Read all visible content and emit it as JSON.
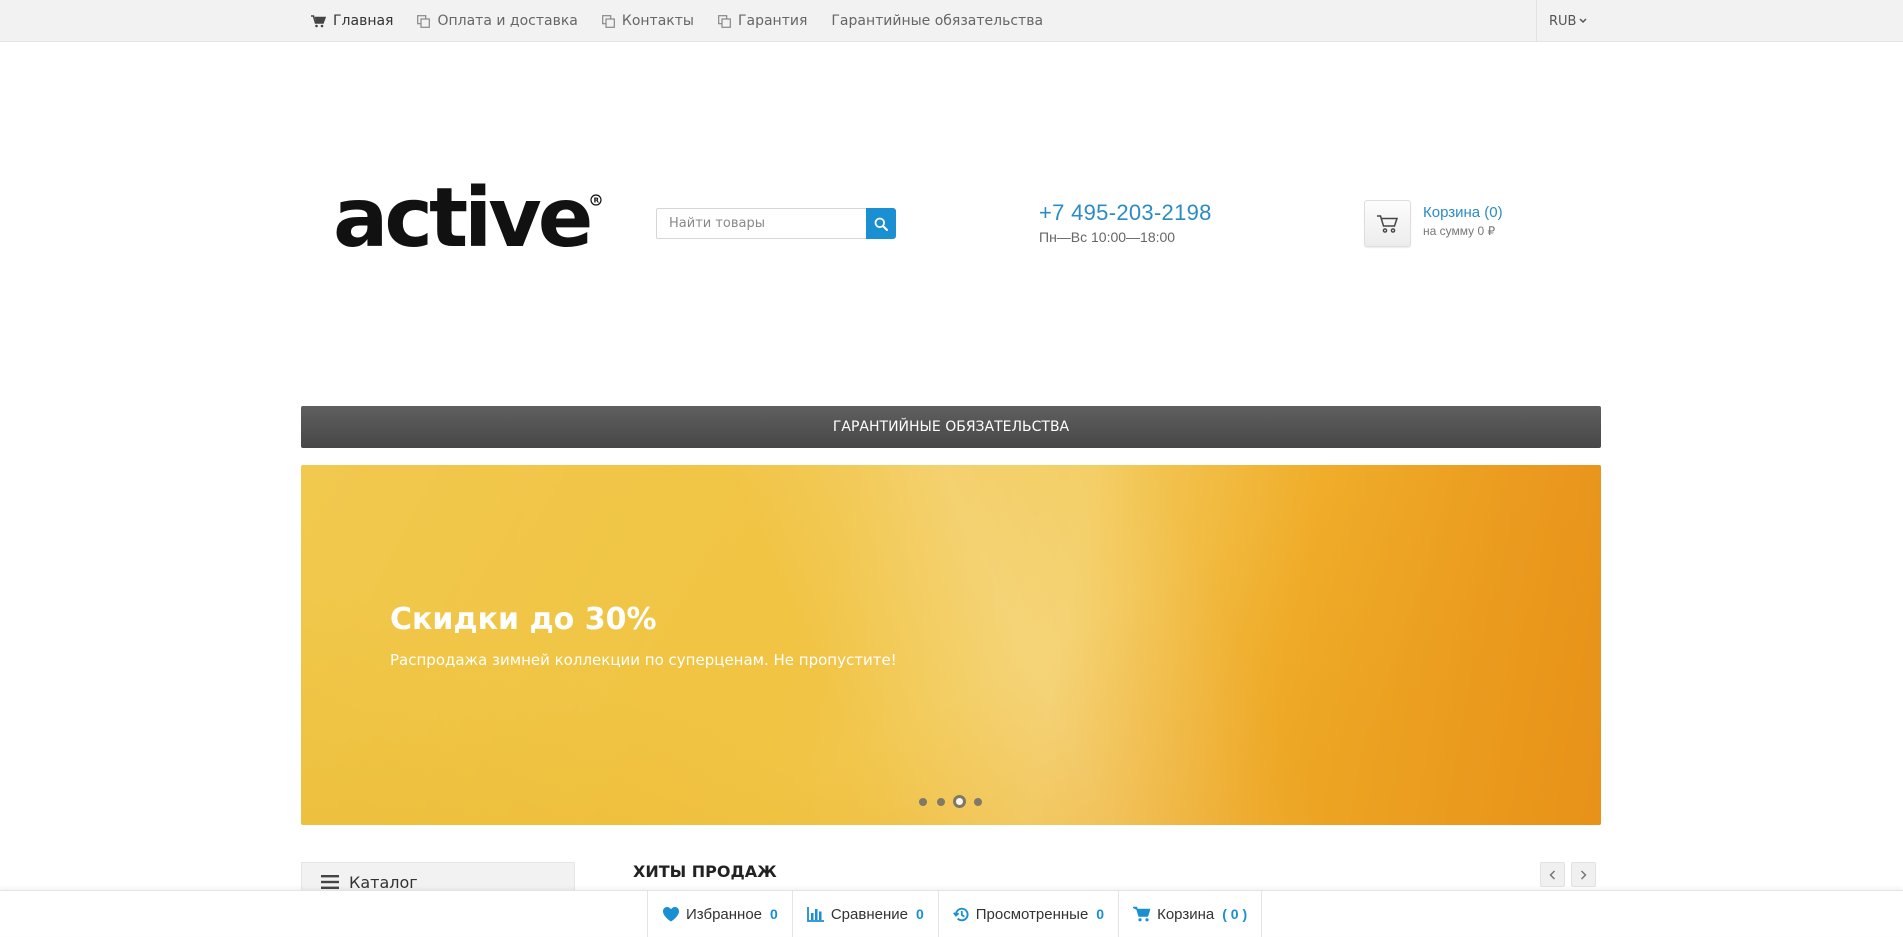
{
  "topnav": {
    "items": [
      {
        "label": "Главная"
      },
      {
        "label": "Оплата и доставка"
      },
      {
        "label": "Контакты"
      },
      {
        "label": "Гарантия"
      },
      {
        "label": "Гарантийные обязательства"
      }
    ],
    "currency": "RUB"
  },
  "header": {
    "logo_text": "active",
    "search_placeholder": "Найти товары",
    "phone": "+7 495-203-2198",
    "hours": "Пн—Вс 10:00—18:00",
    "cart_title": "Корзина (0)",
    "cart_sum": "на сумму 0 ₽"
  },
  "menubar": {
    "label": "ГАРАНТИЙНЫЕ ОБЯЗАТЕЛЬСТВА"
  },
  "banner": {
    "title": "Скидки до 30%",
    "subtitle": "Распродажа зимней коллекции по суперценам. Не пропустите!",
    "slide_count": 4,
    "active_slide": 3
  },
  "catalog": {
    "label": "Каталог"
  },
  "hits": {
    "title": "ХИТЫ ПРОДАЖ"
  },
  "bottombar": {
    "favorites": {
      "label": "Избранное",
      "count": "0"
    },
    "compare": {
      "label": "Сравнение",
      "count": "0"
    },
    "viewed": {
      "label": "Просмотренные",
      "count": "0"
    },
    "cart": {
      "label": "Корзина",
      "count": "( 0 )"
    }
  },
  "colors": {
    "accent": "#1a8fd1",
    "menubar": "#4f4f4f",
    "banner": "#f0c33a"
  }
}
